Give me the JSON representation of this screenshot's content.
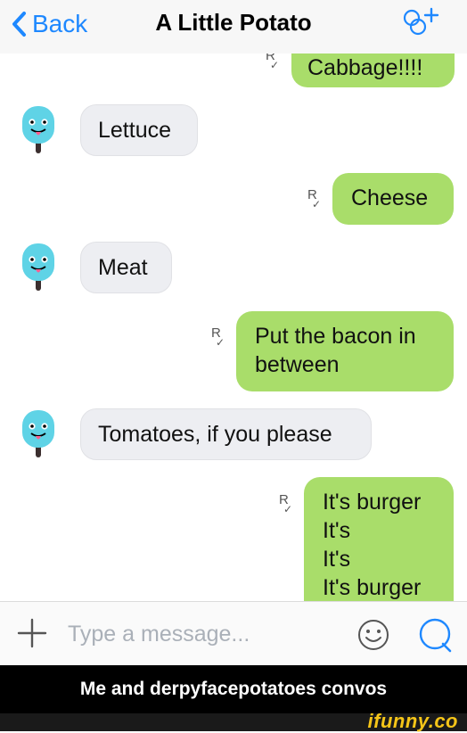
{
  "header": {
    "back_label": "Back",
    "title": "A Little Potato",
    "add_user_icon": "add-person-icon"
  },
  "messages": [
    {
      "from": "me",
      "lines": [
        "Cabbage!!!!"
      ],
      "read": true
    },
    {
      "from": "them",
      "lines": [
        "Lettuce"
      ]
    },
    {
      "from": "me",
      "lines": [
        "Cheese"
      ],
      "read": true
    },
    {
      "from": "them",
      "lines": [
        "Meat"
      ]
    },
    {
      "from": "me",
      "lines": [
        "Put the bacon in",
        "between"
      ],
      "read": true
    },
    {
      "from": "them",
      "lines": [
        "Tomatoes, if you please"
      ]
    },
    {
      "from": "me",
      "lines": [
        "It's burger",
        "It's",
        "It's",
        "It's burger"
      ],
      "read": true
    }
  ],
  "read_receipt": "R",
  "composer": {
    "placeholder": "Type a message...",
    "plus_icon": "plus-icon",
    "emoji_icon": "smiley-icon",
    "send_icon": "quick-reply-icon"
  },
  "caption": "Me and derpyfacepotatoes convos",
  "watermark": "ifunny.co",
  "colors": {
    "accent": "#1e88ff",
    "outgoing_bubble": "#a9dd6a",
    "incoming_bubble": "#edeef2",
    "avatar": "#5fd3e6"
  }
}
